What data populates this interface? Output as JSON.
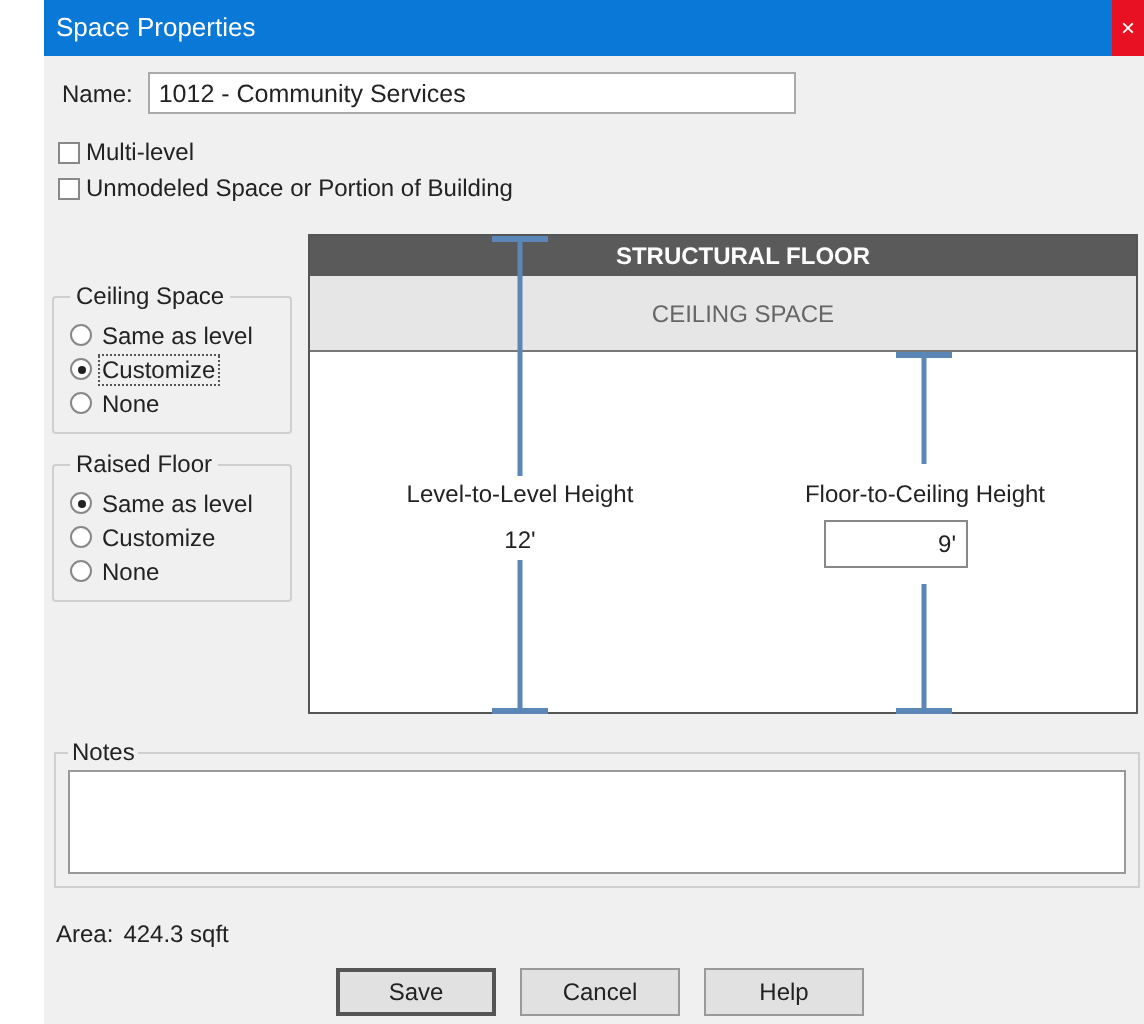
{
  "window": {
    "title": "Space Properties",
    "close": "×"
  },
  "name": {
    "label": "Name:",
    "value": "1012 - Community Services"
  },
  "options": [
    {
      "label": "Multi-level",
      "checked": false
    },
    {
      "label": "Unmodeled Space or Portion of Building",
      "checked": false
    }
  ],
  "ceiling_space": {
    "title": "Ceiling Space",
    "options": [
      {
        "label": "Same as level",
        "selected": false,
        "focused": false
      },
      {
        "label": "Customize",
        "selected": true,
        "focused": true
      },
      {
        "label": "None",
        "selected": false,
        "focused": false
      }
    ]
  },
  "raised_floor": {
    "title": "Raised Floor",
    "options": [
      {
        "label": "Same as level",
        "selected": true,
        "focused": false
      },
      {
        "label": "Customize",
        "selected": false,
        "focused": false
      },
      {
        "label": "None",
        "selected": false,
        "focused": false
      }
    ]
  },
  "diagram": {
    "structural_floor": "STRUCTURAL FLOOR",
    "ceiling_space": "CEILING SPACE",
    "level_to_level": {
      "label": "Level-to-Level Height",
      "value": "12'"
    },
    "floor_to_ceiling": {
      "label": "Floor-to-Ceiling Height",
      "value": "9'"
    }
  },
  "notes": {
    "label": "Notes"
  },
  "area": {
    "label": "Area:",
    "value": "424.3 sqft"
  },
  "buttons": [
    {
      "label": "Save",
      "default": true
    },
    {
      "label": "Cancel",
      "default": false
    },
    {
      "label": "Help",
      "default": false
    }
  ]
}
